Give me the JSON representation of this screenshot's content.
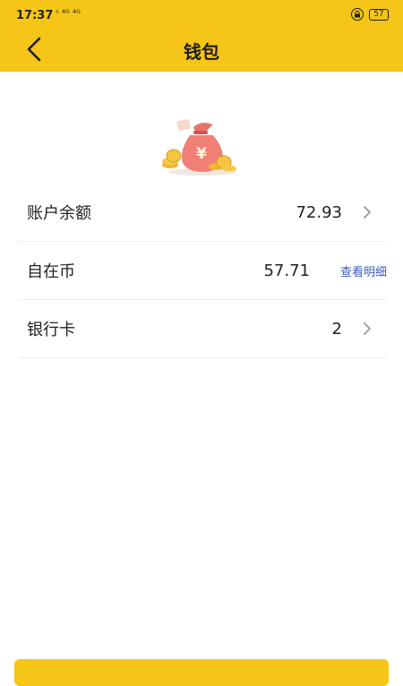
{
  "status_bar": {
    "time": "17:37",
    "signal": "ˢ ⁴ᴳ ⁴ᴳ",
    "battery": "57"
  },
  "header": {
    "title": "钱包"
  },
  "wallet": {
    "rows": [
      {
        "label": "账户余额",
        "value": "72.93"
      },
      {
        "label": "自在币",
        "value": "57.71",
        "link": "查看明细"
      },
      {
        "label": "银行卡",
        "value": "2"
      }
    ]
  },
  "colors": {
    "accent": "#F5C518",
    "link": "#3a5bbf"
  }
}
